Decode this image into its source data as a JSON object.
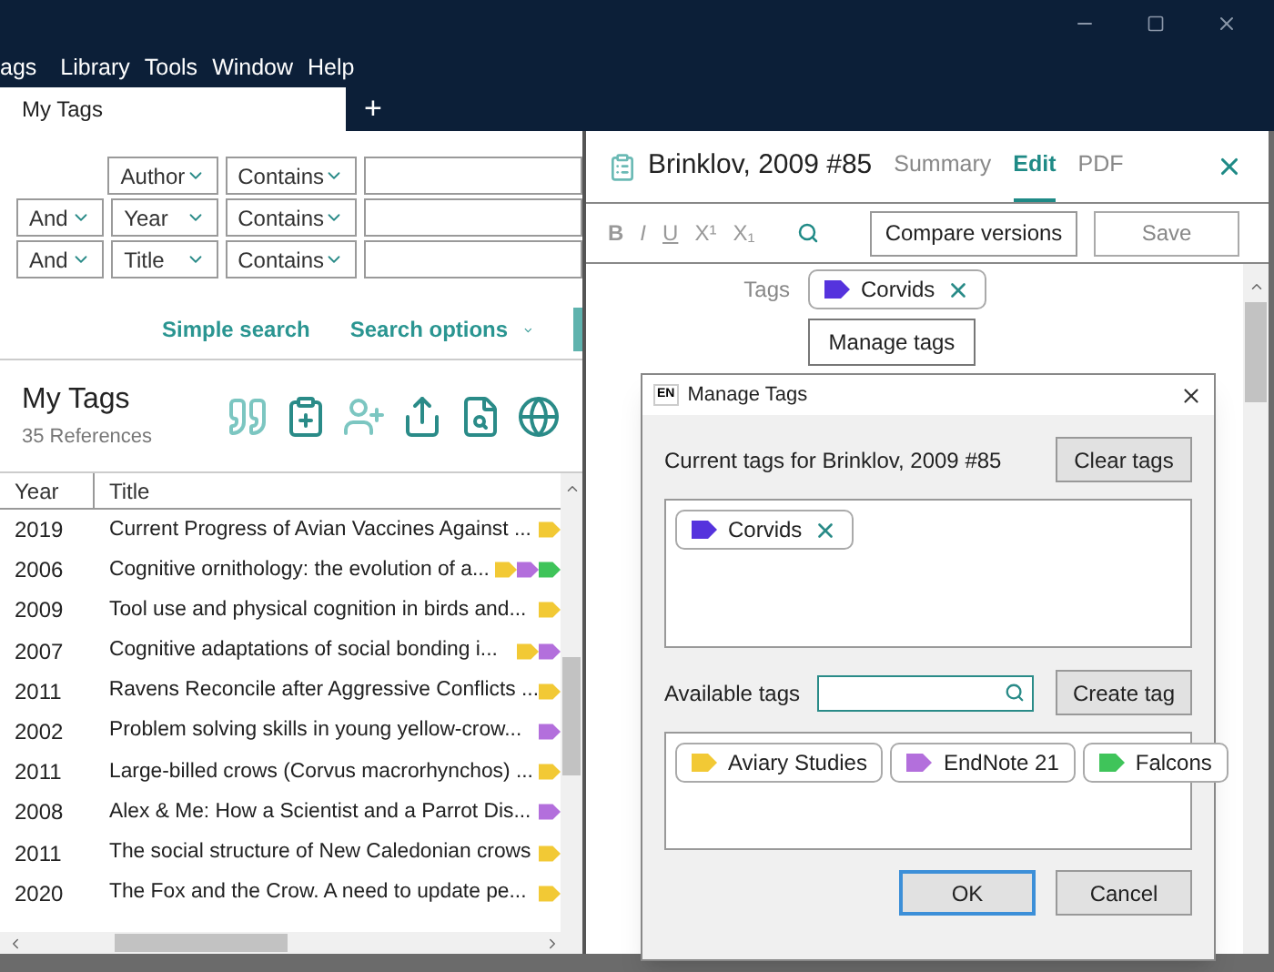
{
  "menu": [
    "ags",
    "Library",
    "Tools",
    "Window",
    "Help"
  ],
  "tabs": [
    {
      "label": "My Tags",
      "selected": true
    }
  ],
  "add_tab": "+",
  "search_rows": [
    {
      "field": "Author",
      "operator": "Contains"
    },
    {
      "connector": "And",
      "field": "Year",
      "operator": "Contains"
    },
    {
      "connector": "And",
      "field": "Title",
      "operator": "Contains"
    }
  ],
  "search_links": {
    "simple": "Simple search",
    "options": "Search options"
  },
  "group": {
    "title": "My Tags",
    "count": "35 References"
  },
  "table": {
    "columns": [
      "Year",
      "Title"
    ],
    "rows": [
      {
        "year": "2019",
        "title": "Current Progress of Avian Vaccines Against ...",
        "tags": [
          {
            "color": "#f2c935"
          }
        ]
      },
      {
        "year": "2006",
        "title": "Cognitive ornithology: the evolution of a...",
        "tags": [
          {
            "color": "#f2c935"
          },
          {
            "color": "#b36fdc"
          },
          {
            "color": "#3fc45a"
          }
        ]
      },
      {
        "year": "2009",
        "title": "Tool use and physical cognition in birds and...",
        "tags": [
          {
            "color": "#f2c935"
          }
        ]
      },
      {
        "year": "2007",
        "title": "Cognitive adaptations of social bonding i...",
        "tags": [
          {
            "color": "#f2c935"
          },
          {
            "color": "#b36fdc"
          }
        ]
      },
      {
        "year": "2011",
        "title": "Ravens Reconcile after Aggressive Conflicts ...",
        "tags": [
          {
            "color": "#f2c935"
          }
        ]
      },
      {
        "year": "2002",
        "title": "Problem solving skills in young yellow-crow...",
        "tags": [
          {
            "color": "#b36fdc"
          }
        ]
      },
      {
        "year": "2011",
        "title": "Large-billed crows (Corvus macrorhynchos) ...",
        "tags": [
          {
            "color": "#f2c935"
          }
        ]
      },
      {
        "year": "2008",
        "title": "Alex & Me: How a Scientist and a Parrot Dis...",
        "tags": [
          {
            "color": "#b36fdc"
          }
        ]
      },
      {
        "year": "2011",
        "title": "The social structure of New Caledonian crows",
        "tags": [
          {
            "color": "#f2c935"
          }
        ]
      },
      {
        "year": "2020",
        "title": "The Fox and the Crow. A need to update pe...",
        "tags": [
          {
            "color": "#f2c935"
          }
        ]
      }
    ]
  },
  "reference": {
    "title": "Brinklov, 2009 #85",
    "tabs": [
      {
        "label": "Summary",
        "selected": false
      },
      {
        "label": "Edit",
        "selected": true
      },
      {
        "label": "PDF",
        "selected": false
      }
    ],
    "format_buttons": [
      "B",
      "I",
      "U",
      "X¹",
      "X₁"
    ],
    "compare": "Compare versions",
    "save": {
      "label": "Save",
      "disabled": true
    },
    "tags_label": "Tags",
    "tags": [
      {
        "label": "Corvids",
        "color": "#5533dd"
      }
    ],
    "manage": "Manage tags"
  },
  "dialog": {
    "badge": "EN",
    "title": "Manage Tags",
    "current_label": "Current tags for Brinklov, 2009 #85",
    "clear": "Clear tags",
    "current_tags": [
      {
        "label": "Corvids",
        "color": "#5533dd"
      }
    ],
    "available_label": "Available tags",
    "create": "Create tag",
    "available_tags": [
      {
        "label": "Aviary Studies",
        "color": "#f2c935"
      },
      {
        "label": "EndNote 21",
        "color": "#b36fdc"
      },
      {
        "label": "Falcons",
        "color": "#3fc45a"
      }
    ],
    "ok": "OK",
    "cancel": "Cancel"
  }
}
